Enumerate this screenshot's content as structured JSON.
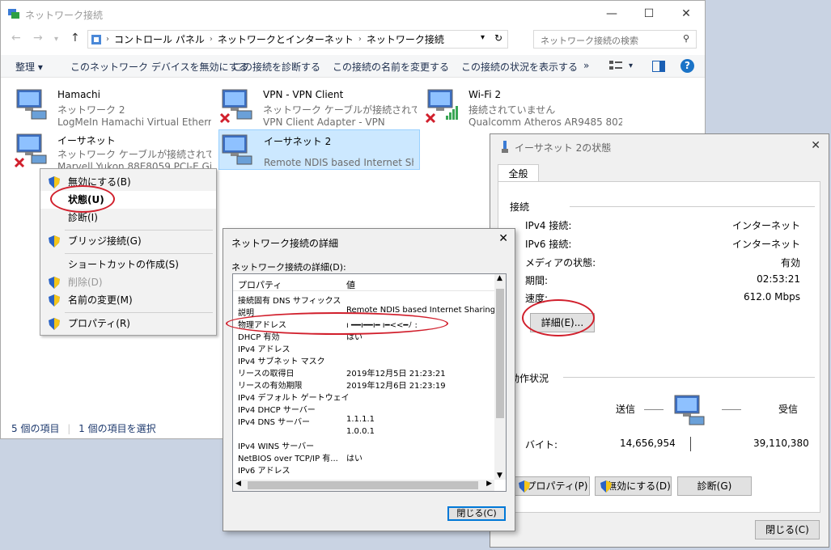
{
  "main_window": {
    "title": "ネットワーク接続",
    "minimize": "—",
    "maximize": "☐",
    "close": "✕"
  },
  "address": {
    "crumbs": [
      "コントロール パネル",
      "ネットワークとインターネット",
      "ネットワーク接続"
    ],
    "search_placeholder": "ネットワーク接続の検索"
  },
  "commands": {
    "organize": "整理 ▾",
    "disable": "このネットワーク デバイスを無効にする",
    "diagnose": "この接続を診断する",
    "rename": "この接続の名前を変更する",
    "status": "この接続の状況を表示する",
    "more": "»",
    "help": "?"
  },
  "adapters": [
    {
      "name": "Hamachi",
      "line2": "ネットワーク 2",
      "line3": "LogMeIn Hamachi Virtual Ethernet...",
      "error": false
    },
    {
      "name": "VPN - VPN Client",
      "line2": "ネットワーク ケーブルが接続されていま...",
      "line3": "VPN Client Adapter - VPN",
      "error": true
    },
    {
      "name": "Wi-Fi 2",
      "line2": "接続されていません",
      "line3": "Qualcomm Atheros AR9485 802.1...",
      "error": true
    },
    {
      "name": "イーサネット",
      "line2": "ネットワーク ケーブルが接続されていま...",
      "line3": "Marvell Yukon 88E8059 PCI-E Giga...",
      "error": true
    },
    {
      "name": "イーサネット 2",
      "line2": "",
      "line3": "Remote NDIS based Internet Shari...",
      "error": false
    }
  ],
  "statusbar": {
    "count": "5 個の項目",
    "selected": "1 個の項目を選択"
  },
  "context_menu": [
    {
      "label": "無効にする(B)",
      "shield": true,
      "disabled": false
    },
    {
      "label": "状態(U)",
      "shield": false,
      "disabled": false,
      "bold": true
    },
    {
      "label": "診断(I)",
      "shield": false,
      "disabled": false
    },
    {
      "label": "ブリッジ接続(G)",
      "shield": true,
      "disabled": false
    },
    {
      "label": "ショートカットの作成(S)",
      "shield": false,
      "disabled": false
    },
    {
      "label": "削除(D)",
      "shield": true,
      "disabled": true
    },
    {
      "label": "名前の変更(M)",
      "shield": true,
      "disabled": false
    },
    {
      "label": "プロパティ(R)",
      "shield": true,
      "disabled": false
    }
  ],
  "details": {
    "title": "ネットワーク接続の詳細",
    "label": "ネットワーク接続の詳細(D):",
    "col_prop": "プロパティ",
    "col_val": "値",
    "rows": [
      {
        "k": "接続固有 DNS サフィックス",
        "v": ""
      },
      {
        "k": "説明",
        "v": "Remote NDIS based Internet Sharing D"
      },
      {
        "k": "物理アドレス",
        "v": "ı ━━ı━━ı━ ı━<<━ﾉ :"
      },
      {
        "k": "DHCP 有効",
        "v": "はい"
      },
      {
        "k": "IPv4 アドレス",
        "v": ""
      },
      {
        "k": "IPv4 サブネット マスク",
        "v": ""
      },
      {
        "k": "リースの取得日",
        "v": "2019年12月5日 21:23:21"
      },
      {
        "k": "リースの有効期限",
        "v": "2019年12月6日 21:23:19"
      },
      {
        "k": "IPv4 デフォルト ゲートウェイ",
        "v": ""
      },
      {
        "k": "IPv4 DHCP サーバー",
        "v": ""
      },
      {
        "k": "IPv4 DNS サーバー",
        "v": "1.1.1.1"
      },
      {
        "k": "",
        "v": "1.0.0.1"
      },
      {
        "k": "IPv4 WINS サーバー",
        "v": ""
      },
      {
        "k": "NetBIOS over TCP/IP 有...",
        "v": "はい"
      },
      {
        "k": "IPv6 アドレス",
        "v": ""
      }
    ],
    "close_button": "閉じる(C)"
  },
  "status_window": {
    "title": "イーサネット 2の状態",
    "close": "✕",
    "tab": "全般",
    "section_connection": "接続",
    "fields": [
      {
        "k": "IPv4 接続:",
        "v": "インターネット"
      },
      {
        "k": "IPv6 接続:",
        "v": "インターネット"
      },
      {
        "k": "メディアの状態:",
        "v": "有効"
      },
      {
        "k": "期間:",
        "v": "02:53:21"
      },
      {
        "k": "速度:",
        "v": "612.0 Mbps"
      }
    ],
    "details_button": "詳細(E)...",
    "section_activity": "動作状況",
    "sent_label": "送信",
    "recv_label": "受信",
    "bytes_label": "バイト:",
    "bytes_sent": "14,656,954",
    "bytes_recv": "39,110,380",
    "props_button": "プロパティ(P)",
    "disable_button": "無効にする(D)",
    "diagnose_button": "診断(G)",
    "close_button": "閉じる(C)"
  },
  "colors": {
    "accent": "#0078d7",
    "annotation_red": "#d11f2c",
    "selection": "#cce8ff"
  }
}
